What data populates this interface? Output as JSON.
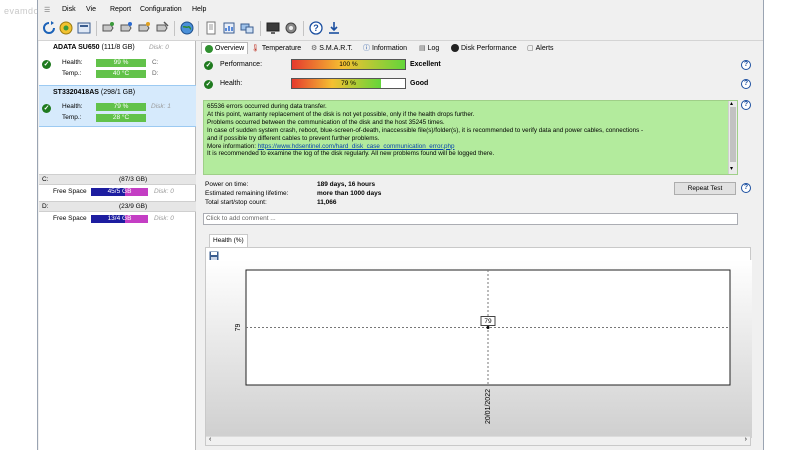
{
  "watermark": "evamdolab.com",
  "menu": [
    "Disk",
    "Vie",
    "Report",
    "Configuration",
    "Help"
  ],
  "disks": [
    {
      "name": "ADATA SU650",
      "size": "(111/8 GB)",
      "index": "Disk: 0",
      "health_label": "Health:",
      "health": "99 %",
      "health_value": 99,
      "health_drive": "C:",
      "temp_label": "Temp.:",
      "temp": "40 °C",
      "temp_drive": "D:"
    },
    {
      "name": "ST3320418AS",
      "size": "(298/1 GB)",
      "index": "Disk: 1",
      "health_label": "Health:",
      "health": "79 %",
      "health_value": 79,
      "temp_label": "Temp.:",
      "temp": "28 °C"
    }
  ],
  "drives": [
    {
      "letter": "C:",
      "size": "(87/3 GB)",
      "free_label": "Free Space",
      "free": "45/5 GB",
      "index": "Disk: 0"
    },
    {
      "letter": "D:",
      "size": "(23/9 GB)",
      "free_label": "Free Space",
      "free": "13/4 GB",
      "index": "Disk: 0"
    }
  ],
  "tabs": [
    "Overview",
    "Temperature",
    "S.M.A.R.T.",
    "Information",
    "Log",
    "Disk Performance",
    "Alerts"
  ],
  "overview": {
    "performance_label": "Performance:",
    "performance_value": "100 %",
    "performance_fill": 100,
    "performance_status": "Excellent",
    "health_label": "Health:",
    "health_value": "79 %",
    "health_fill": 79,
    "health_status": "Good"
  },
  "message": {
    "line1": "65536 errors occurred during data transfer.",
    "line2": "At this point, warranty replacement of the disk is not yet possible, only if the health drops further.",
    "line3": "Problems occurred between the communication of the disk and the host 35245 times.",
    "line4": "In case of sudden system crash, reboot, blue-screen-of-death, inaccessible file(s)/folder(s), it is recommended to verify data and power cables, connections -",
    "line5": "and if possible try different cables to prevent further problems.",
    "more_label": "More information:",
    "link": "https://www.hdsentinel.com/hard_disk_case_communication_error.php",
    "line7": "It is recommended to examine the log of the disk regularly. All new problems found will be logged there."
  },
  "stats": {
    "power_on_label": "Power on time:",
    "power_on": "189 days, 16 hours",
    "lifetime_label": "Estimated remaining lifetime:",
    "lifetime": "more than 1000 days",
    "startstop_label": "Total start/stop count:",
    "startstop": "11,066"
  },
  "repeat_test": "Repeat Test",
  "comment_placeholder": "Click to add comment ...",
  "chart_tab": "Health (%)",
  "chart_data": {
    "type": "line",
    "title": "",
    "xlabel": "",
    "ylabel": "",
    "x": [
      "20/01/2022"
    ],
    "series": [
      {
        "values": [
          79
        ]
      }
    ],
    "tick_y": "79",
    "point_label": "79"
  }
}
